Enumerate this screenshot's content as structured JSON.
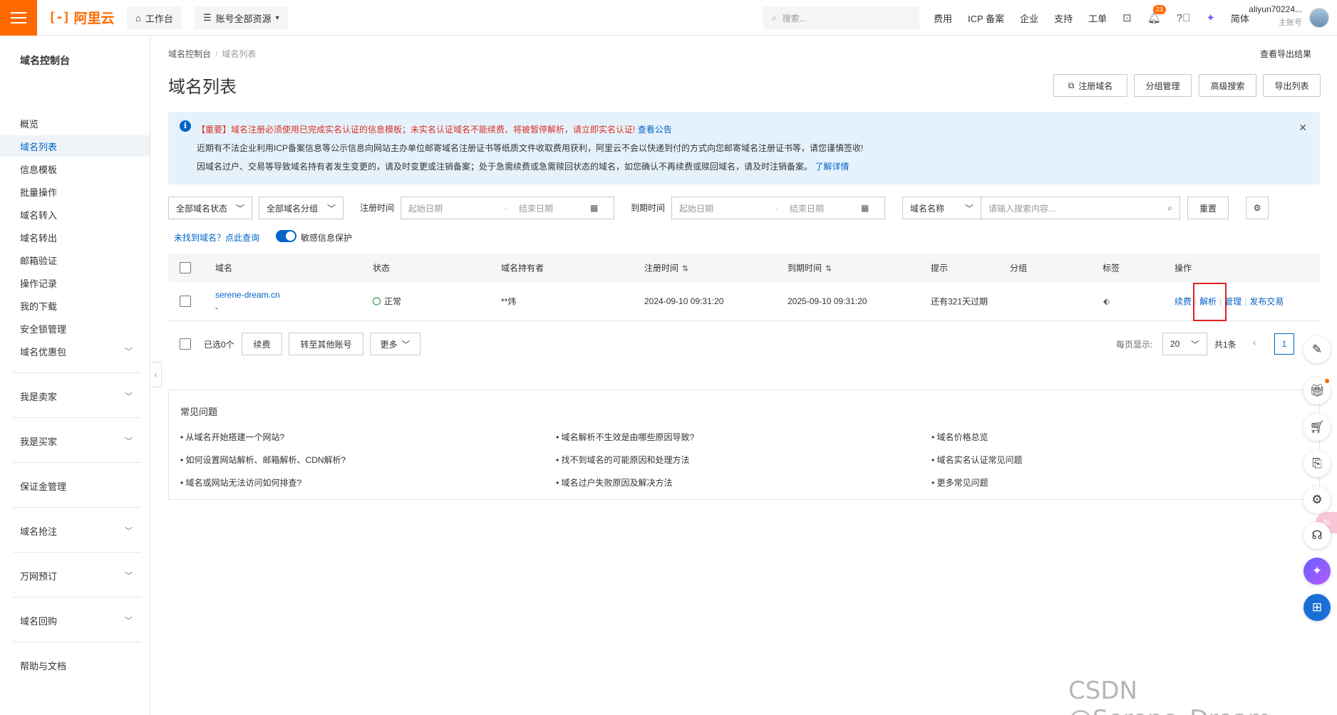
{
  "topbar": {
    "logo_mark": "[-]",
    "logo_text": "阿里云",
    "workbench": "工作台",
    "resources": "账号全部资源",
    "search_placeholder": "搜索...",
    "nav": [
      "费用",
      "ICP 备案",
      "企业",
      "支持",
      "工单"
    ],
    "notification_count": "23",
    "language": "简体",
    "user_name": "aliyun70224...",
    "user_role": "主账号"
  },
  "sidebar": {
    "title": "域名控制台",
    "items": [
      "概览",
      "域名列表",
      "信息模板",
      "批量操作",
      "域名转入",
      "域名转出",
      "邮箱验证",
      "操作记录",
      "我的下载",
      "安全锁管理",
      "域名优惠包"
    ],
    "groups": [
      "我是卖家",
      "我是买家",
      "保证金管理",
      "域名抢注",
      "万网预订",
      "域名回购",
      "帮助与文档"
    ]
  },
  "breadcrumb": {
    "root": "域名控制台",
    "current": "域名列表"
  },
  "export_result": "查看导出结果",
  "page_title": "域名列表",
  "actions": {
    "register": "注册域名",
    "group_manage": "分组管理",
    "advanced_search": "高级搜索",
    "export": "导出列表"
  },
  "notice": {
    "line1_important": "【重要】域名注册必须使用已完成实名认证的信息模板；未实名认证域名不能续费、将被暂停解析，请立即实名认证!",
    "line1_link": "查看公告",
    "line2": "近期有不法企业利用ICP备案信息等公示信息向网站主办单位邮寄域名注册证书等纸质文件收取费用获利，阿里云不会以快递到付的方式向您邮寄域名注册证书等，请您谨慎签收!",
    "line3": "因域名过户、交易等导致域名持有者发生变更的，请及时变更或注销备案；处于急需续费或急需赎回状态的域名，如您确认不再续费或赎回域名，请及时注销备案。",
    "line3_link": "了解详情"
  },
  "filters": {
    "status": "全部域名状态",
    "group": "全部域名分组",
    "reg_time_label": "注册时间",
    "exp_time_label": "到期时间",
    "start_date": "起始日期",
    "end_date": "结束日期",
    "search_field": "域名名称",
    "search_placeholder": "请输入搜索内容...",
    "reset": "重置"
  },
  "not_found_link": "未找到域名？点此查询",
  "privacy_toggle": "敏感信息保护",
  "table": {
    "headers": [
      "域名",
      "状态",
      "域名持有者",
      "注册时间",
      "到期时间",
      "提示",
      "分组",
      "标签",
      "操作"
    ],
    "rows": [
      {
        "domain": "serene-dream.cn",
        "sub": "-",
        "status": "正常",
        "holder": "**炜",
        "reg_time": "2024-09-10 09:31:20",
        "exp_time": "2025-09-10 09:31:20",
        "hint": "还有321天过期",
        "ops": [
          "续费",
          "解析",
          "管理",
          "发布交易"
        ]
      }
    ]
  },
  "batch": {
    "selected": "已选0个",
    "renew": "续费",
    "transfer": "转至其他账号",
    "more": "更多"
  },
  "pager": {
    "label": "每页显示:",
    "size": "20",
    "total": "共1条",
    "page": "1"
  },
  "faq": {
    "title": "常见问题",
    "items": [
      "• 从域名开始搭建一个网站?",
      "• 域名解析不生效是由哪些原因导致?",
      "• 域名价格总览",
      "• 如何设置网站解析、邮箱解析、CDN解析?",
      "• 找不到域名的可能原因和处理方法",
      "• 域名实名认证常见问题",
      "• 域名或网站无法访问如何排查?",
      "• 域名过户失败原因及解决方法",
      "• 更多常见问题"
    ]
  },
  "ai_tag": "Ai",
  "watermark": "CSDN @Serene_Dream",
  "colors": {
    "brand": "#ff6a00",
    "link": "#0064c8",
    "warning_text": "#d93026",
    "highlight_box": "#e02020"
  }
}
